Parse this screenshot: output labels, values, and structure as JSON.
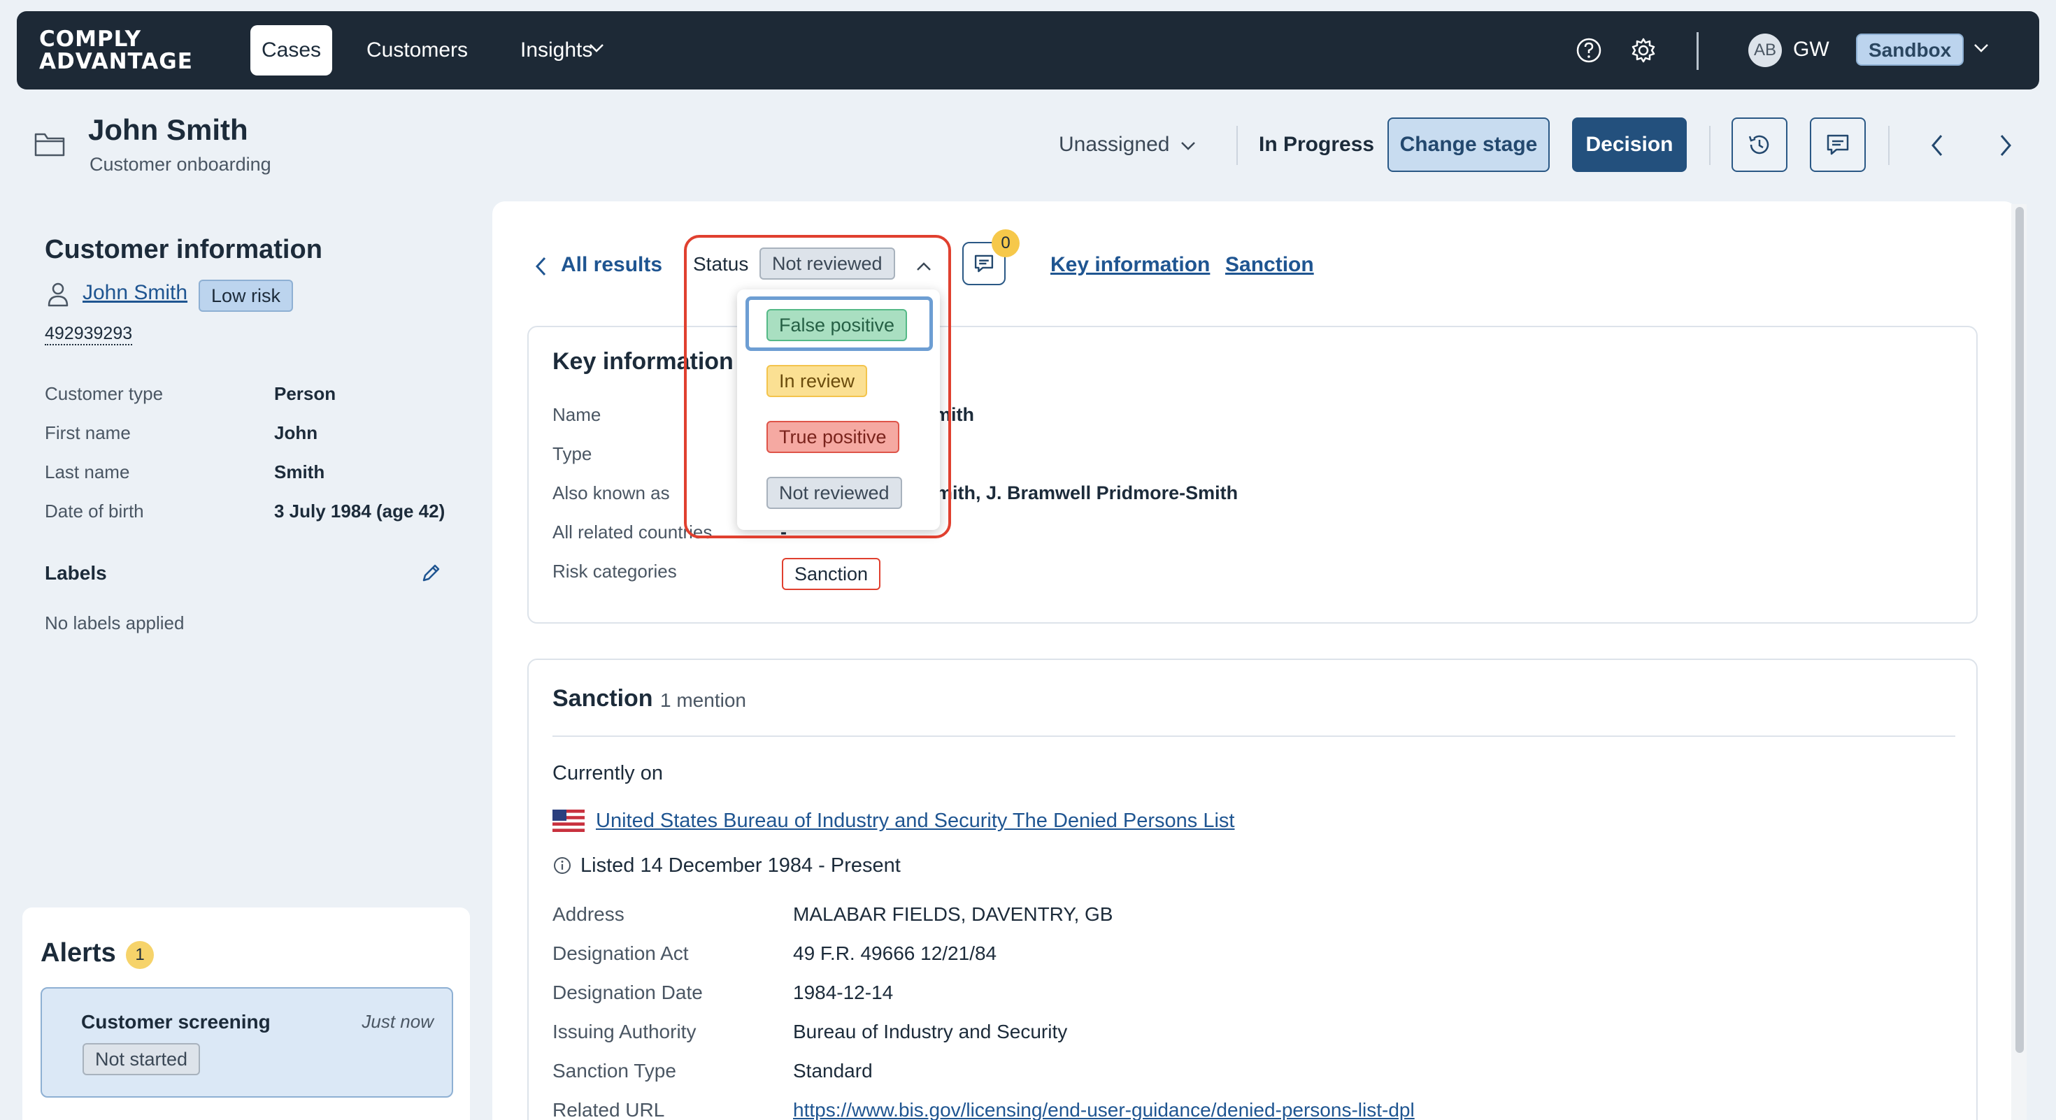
{
  "nav": {
    "logo_line1": "COMPLY",
    "logo_line2": "ADVANTAGE",
    "cases": "Cases",
    "customers": "Customers",
    "insights": "Insights",
    "avatar_initials": "AB",
    "user_initials": "GW",
    "environment": "Sandbox"
  },
  "case": {
    "title": "John Smith",
    "subtitle": "Customer onboarding",
    "assignee": "Unassigned",
    "stage": "In Progress",
    "change_stage": "Change stage",
    "decision": "Decision"
  },
  "customer_info": {
    "title": "Customer information",
    "name": "John Smith",
    "risk": "Low risk",
    "id": "492939293",
    "rows": [
      {
        "label": "Customer type",
        "value": "Person"
      },
      {
        "label": "First name",
        "value": "John"
      },
      {
        "label": "Last name",
        "value": "Smith"
      },
      {
        "label": "Date of birth",
        "value": "3 July 1984 (age 42)"
      }
    ],
    "labels_title": "Labels",
    "no_labels": "No labels applied"
  },
  "alerts": {
    "title": "Alerts",
    "count": "1",
    "item": {
      "name": "Customer screening",
      "time": "Just now",
      "status": "Not started"
    }
  },
  "result": {
    "back": "All results",
    "status_label": "Status",
    "status_value": "Not reviewed",
    "comment_count": "0",
    "anchor_key": "Key information",
    "anchor_sanction": "Sanction",
    "dropdown": {
      "false_positive": "False positive",
      "in_review": "In review",
      "true_positive": "True positive",
      "not_reviewed": "Not reviewed"
    }
  },
  "key_info": {
    "title": "Key information",
    "rows": [
      {
        "label": "Name",
        "value": "mith"
      },
      {
        "label": "Type",
        "value": ""
      },
      {
        "label": "Also known as",
        "value": "mith, J. Bramwell Pridmore-Smith"
      },
      {
        "label": "All related countries",
        "value": "-"
      }
    ],
    "risk_label": "Risk categories",
    "risk_value": "Sanction"
  },
  "sanction": {
    "title": "Sanction",
    "mentions": "1 mention",
    "currently_on": "Currently on",
    "list_name": "United States Bureau of Industry and Security The Denied Persons List",
    "listed": "Listed 14 December 1984 - Present",
    "rows": [
      {
        "label": "Address",
        "value": "MALABAR FIELDS, DAVENTRY, GB"
      },
      {
        "label": "Designation Act",
        "value": "49 F.R. 49666 12/21/84"
      },
      {
        "label": "Designation Date",
        "value": "1984-12-14"
      },
      {
        "label": "Issuing Authority",
        "value": "Bureau of Industry and Security"
      },
      {
        "label": "Sanction Type",
        "value": "Standard"
      },
      {
        "label": "Related URL",
        "value": "https://www.bis.gov/licensing/end-user-guidance/denied-persons-list-dpl"
      }
    ]
  },
  "colors": {
    "nav_bg": "#1d2936",
    "primary": "#23507d",
    "link": "#1f5591",
    "highlight": "#e0402f",
    "page_bg": "#ecf1f6"
  }
}
